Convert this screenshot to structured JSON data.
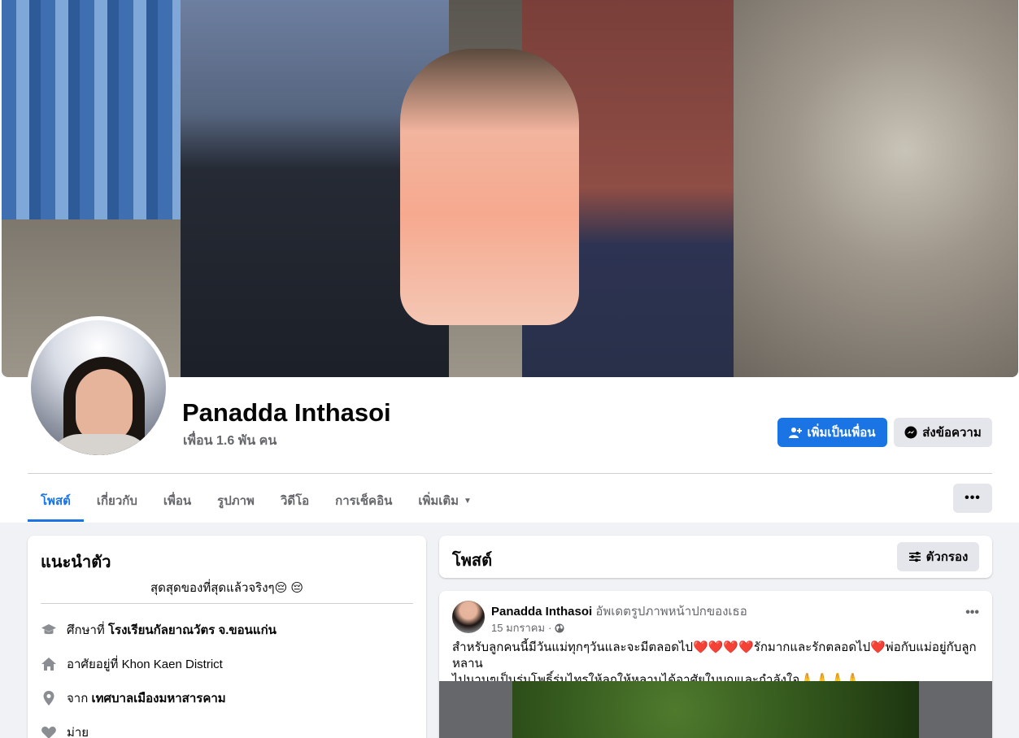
{
  "profile": {
    "name": "Panadda Inthasoi",
    "friends": "เพื่อน 1.6 พัน คน",
    "add_friend": "เพิ่มเป็นเพื่อน",
    "message": "ส่งข้อความ"
  },
  "tabs": [
    {
      "label": "โพสต์",
      "active": true
    },
    {
      "label": "เกี่ยวกับ"
    },
    {
      "label": "เพื่อน"
    },
    {
      "label": "รูปภาพ"
    },
    {
      "label": "วิดีโอ"
    },
    {
      "label": "การเช็คอิน"
    },
    {
      "label": "เพิ่มเติม"
    }
  ],
  "more_label": "•••",
  "intro": {
    "title": "แนะนำตัว",
    "bio": "สุดสุดของที่สุดแล้วจริงๆ😔 😔",
    "education_prefix": "ศึกษาที่ ",
    "education": "โรงเรียนกัลยาณวัตร จ.ขอนแก่น",
    "lives_in": "อาศัยอยู่ที่ Khon Kaen District",
    "from_prefix": "จาก ",
    "from": "เทศบาลเมืองมหาสารคาม",
    "relationship": "ม่าย"
  },
  "posts": {
    "title": "โพสต์",
    "filter": "ตัวกรอง"
  },
  "post": {
    "author": "Panadda Inthasoi",
    "action": " อัพเดตรูปภาพหน้าปกของเธอ",
    "date": "15 มกราคม",
    "more": "•••",
    "text_line1": "สำหรับลูกคนนี้มีวันแม่ทุกๆวันและจะมีตลอดไป❤️❤️❤️❤️รักมากและรักตลอดไป❤️พ่อกับแม่อยู่กับลูกหลาน",
    "text_line2": "ไปนานๆเป็นร่มโพธิ์ร่มไทรให้ลูกให้หลานได้อาศัยใบบุญและกำลังใจ🙏🙏🙏🙏"
  },
  "colors": {
    "primary": "#1b74e4",
    "secondary_bg": "#e4e6eb",
    "page_bg": "#f0f2f5",
    "muted_text": "#65676b"
  }
}
